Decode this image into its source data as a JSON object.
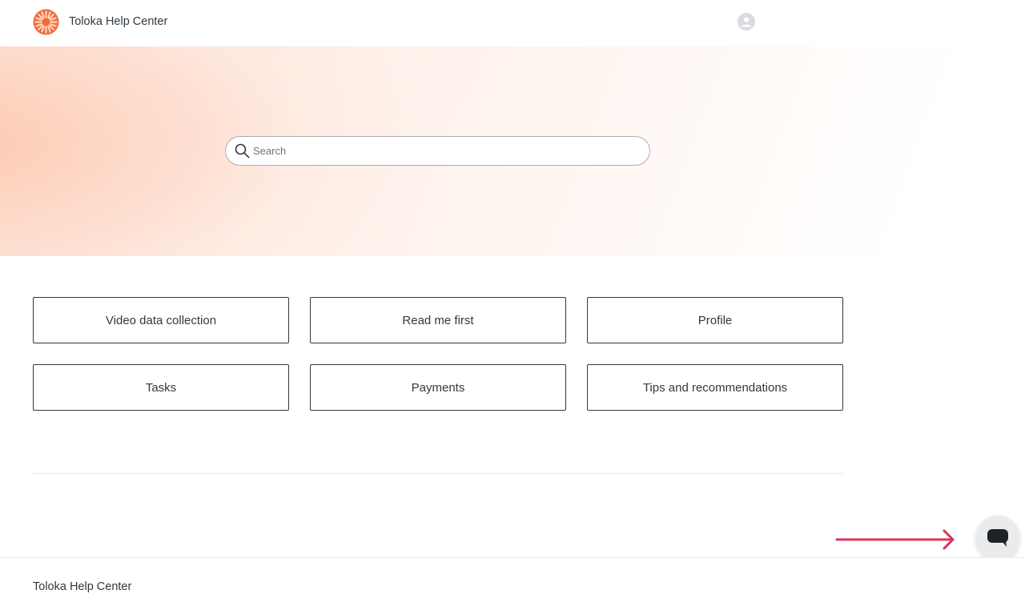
{
  "header": {
    "logo_icon": "toloka-sunburst-logo-icon",
    "brand_name": "Toloka Help Center",
    "avatar_icon": "user-avatar-icon"
  },
  "search": {
    "placeholder": "Search",
    "value": "",
    "icon": "search-icon"
  },
  "categories": [
    {
      "label": "Video data collection"
    },
    {
      "label": "Read me first"
    },
    {
      "label": "Profile"
    },
    {
      "label": "Tasks"
    },
    {
      "label": "Payments"
    },
    {
      "label": "Tips and recommendations"
    }
  ],
  "annotation": {
    "icon": "arrow-right-icon",
    "color": "#d6365a"
  },
  "chat_launcher": {
    "icon": "chat-bubble-icon"
  },
  "footer": {
    "brand_name": "Toloka Help Center"
  },
  "colors": {
    "accent": "#f26b3a",
    "text": "#2f3941",
    "hero_peach": "#fdc9b0",
    "arrow": "#d6365a"
  }
}
